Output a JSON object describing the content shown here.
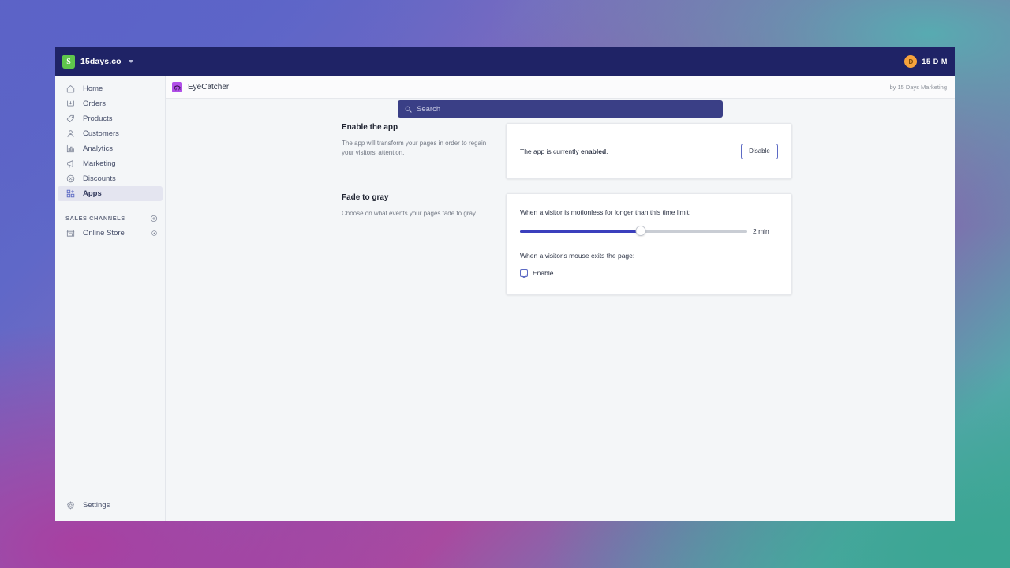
{
  "topbar": {
    "store_name": "15days.co",
    "store_caret_icon": "chevron-down-icon",
    "logo_icon": "shopify-bag-icon",
    "search": {
      "icon": "search-icon",
      "placeholder": "Search",
      "value": ""
    },
    "user": {
      "avatar_initial": "D",
      "name": "15 D M",
      "avatar_color": "#f7a33c"
    }
  },
  "sidebar": {
    "items": [
      {
        "label": "Home",
        "icon": "home-icon",
        "active": false
      },
      {
        "label": "Orders",
        "icon": "orders-icon",
        "active": false
      },
      {
        "label": "Products",
        "icon": "tag-icon",
        "active": false
      },
      {
        "label": "Customers",
        "icon": "person-icon",
        "active": false
      },
      {
        "label": "Analytics",
        "icon": "bar-chart-icon",
        "active": false
      },
      {
        "label": "Marketing",
        "icon": "megaphone-icon",
        "active": false
      },
      {
        "label": "Discounts",
        "icon": "discount-icon",
        "active": false
      },
      {
        "label": "Apps",
        "icon": "apps-grid-icon",
        "active": true
      }
    ],
    "sales_channels": {
      "heading": "SALES CHANNELS",
      "add_icon": "plus-circle-icon",
      "items": [
        {
          "label": "Online Store",
          "icon": "storefront-icon",
          "action_icon": "eye-icon"
        }
      ]
    },
    "settings": {
      "label": "Settings",
      "icon": "gear-icon"
    },
    "active_bg": "#e4e5f0"
  },
  "app_header": {
    "icon": "eyecatcher-app-icon",
    "icon_color": "#b14fe8",
    "title": "EyeCatcher",
    "author": "by 15 Days Marketing"
  },
  "main": {
    "sections": [
      {
        "title": "Enable the app",
        "subtitle": "The app will transform your pages in order to regain your visitors' attention."
      },
      {
        "title": "Fade to gray",
        "subtitle": "Choose on what events your pages fade to gray."
      }
    ],
    "enable_card": {
      "status_prefix": "The app is currently ",
      "status_state": "enabled",
      "status_suffix": ".",
      "button_label": "Disable"
    },
    "fade_card": {
      "slider_label": "When a visitor is motionless for longer than this time limit:",
      "slider_value": "2 min",
      "slider_percent": 53,
      "slider_fill_color": "#3b3fbd",
      "mouse_exit_label": "When a visitor's mouse exits the page:",
      "checkbox_label": "Enable",
      "checkbox_checked": true,
      "checkbox_color": "#5c6ac4"
    }
  }
}
